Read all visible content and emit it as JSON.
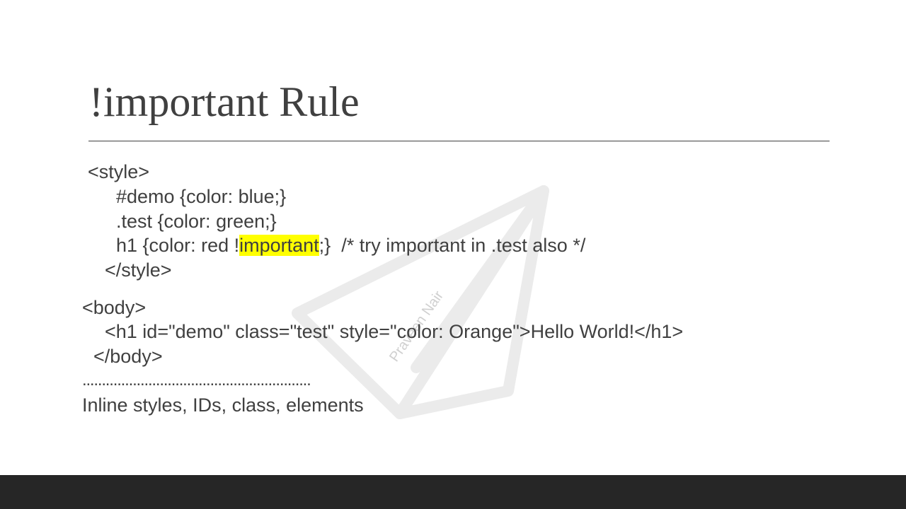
{
  "slide": {
    "title": "!important Rule",
    "watermark_text": "Praveen Nair",
    "code": {
      "line1": "<style>",
      "line2": "#demo {color: blue;}",
      "line3": ".test {color: green;}",
      "line4_before": "h1 {color: red !",
      "line4_highlight": "important",
      "line4_after": ";}  /* try important in .test also */",
      "line5": "</style>",
      "line6": "<body>",
      "line7": "<h1 id=\"demo\" class=\"test\" style=\"color: Orange\">Hello World!</h1>",
      "line8": "</body>",
      "dots": "...........................................................",
      "summary": "Inline styles, IDs, class, elements"
    }
  },
  "colors": {
    "text": "#404040",
    "highlight": "#ffff00",
    "footer": "#262626",
    "watermark": "#ebebeb"
  }
}
